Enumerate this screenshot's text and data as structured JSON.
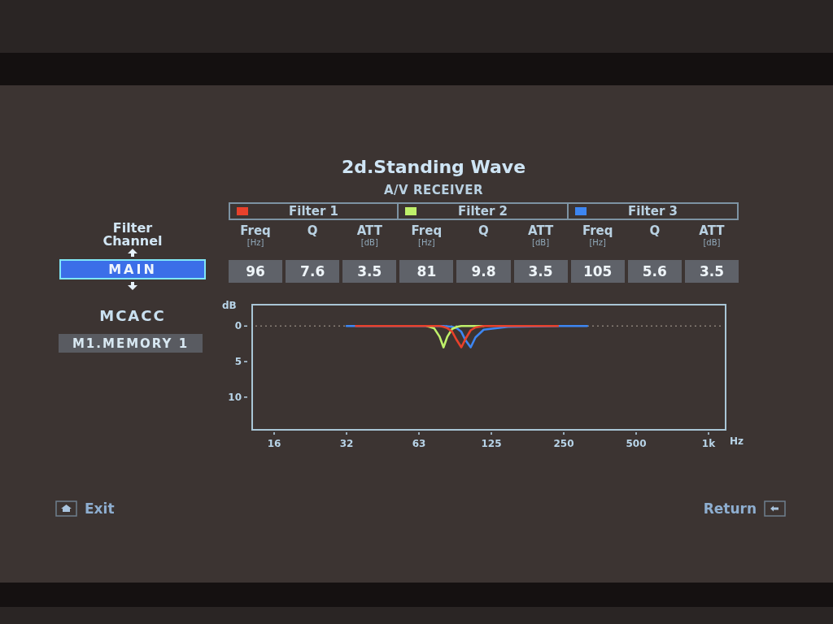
{
  "title": "2d.Standing Wave",
  "subtitle": "A/V RECEIVER",
  "filter_channel": {
    "label": "Filter Channel",
    "value": "MAIN",
    "selected": true
  },
  "mcacc": {
    "label": "MCACC",
    "value": "M1.MEMORY 1"
  },
  "filters": [
    {
      "name": "Filter 1",
      "color": "#e8412b",
      "params": [
        {
          "label": "Freq",
          "unit": "[Hz]",
          "value": "96"
        },
        {
          "label": "Q",
          "value": "7.6"
        },
        {
          "label": "ATT",
          "unit": "[dB]",
          "value": "3.5"
        }
      ]
    },
    {
      "name": "Filter 2",
      "color": "#bff06a",
      "params": [
        {
          "label": "Freq",
          "unit": "[Hz]",
          "value": "81"
        },
        {
          "label": "Q",
          "value": "9.8"
        },
        {
          "label": "ATT",
          "unit": "[dB]",
          "value": "3.5"
        }
      ]
    },
    {
      "name": "Filter 3",
      "color": "#3d86f2",
      "params": [
        {
          "label": "Freq",
          "unit": "[Hz]",
          "value": "105"
        },
        {
          "label": "Q",
          "value": "5.6"
        },
        {
          "label": "ATT",
          "unit": "[dB]",
          "value": "3.5"
        }
      ]
    }
  ],
  "graph": {
    "y_unit": "dB",
    "y_ticks": [
      "0",
      "5",
      "10"
    ],
    "x_ticks": [
      "16",
      "32",
      "63",
      "125",
      "250",
      "500",
      "1k"
    ],
    "x_unit": "Hz"
  },
  "footer": {
    "exit": "Exit",
    "return": "Return"
  }
}
